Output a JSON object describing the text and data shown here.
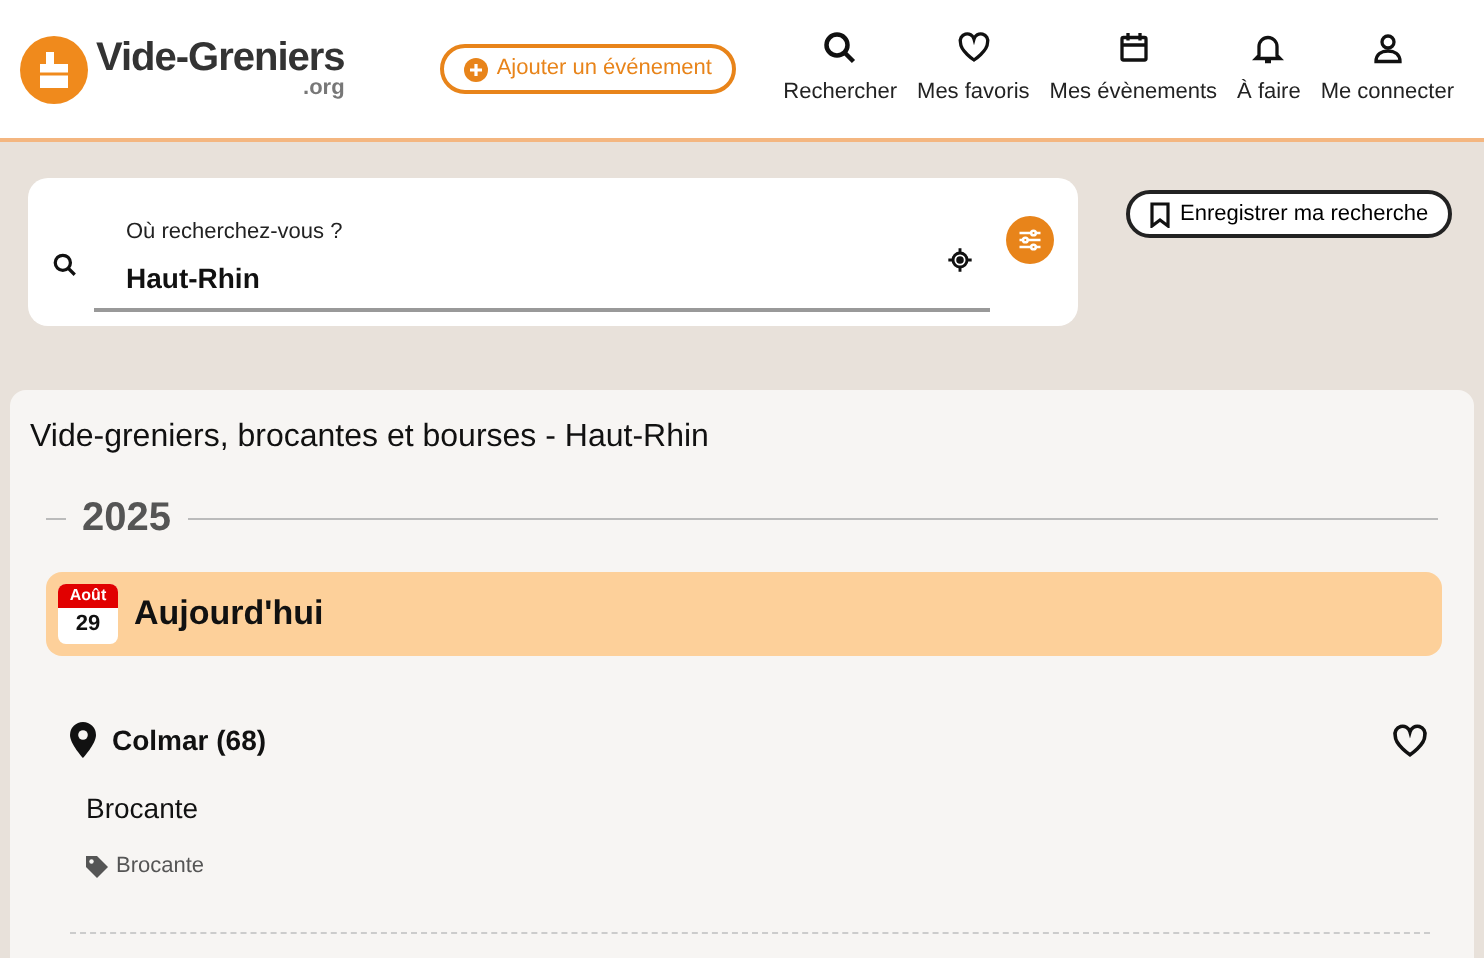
{
  "header": {
    "logo": {
      "name": "Vide-Greniers",
      "suffix": ".org"
    },
    "add_button": "Ajouter un événement",
    "nav": [
      {
        "kind": "search",
        "label": "Rechercher"
      },
      {
        "kind": "heart",
        "label": "Mes favoris"
      },
      {
        "kind": "calendar",
        "label": "Mes évènements"
      },
      {
        "kind": "bell",
        "label": "À faire"
      },
      {
        "kind": "user",
        "label": "Me connecter"
      }
    ]
  },
  "search": {
    "label": "Où recherchez-vous ?",
    "value": "Haut-Rhin"
  },
  "save_button": "Enregistrer ma recherche",
  "results": {
    "title": "Vide-greniers, brocantes et bourses - Haut-Rhin",
    "year": "2025",
    "days": [
      {
        "month": "Août",
        "day": "29",
        "label": "Aujourd'hui",
        "events": [
          {
            "city": "Colmar (68)",
            "name": "Brocante",
            "tag": "Brocante",
            "favorite": false
          }
        ]
      }
    ]
  }
}
